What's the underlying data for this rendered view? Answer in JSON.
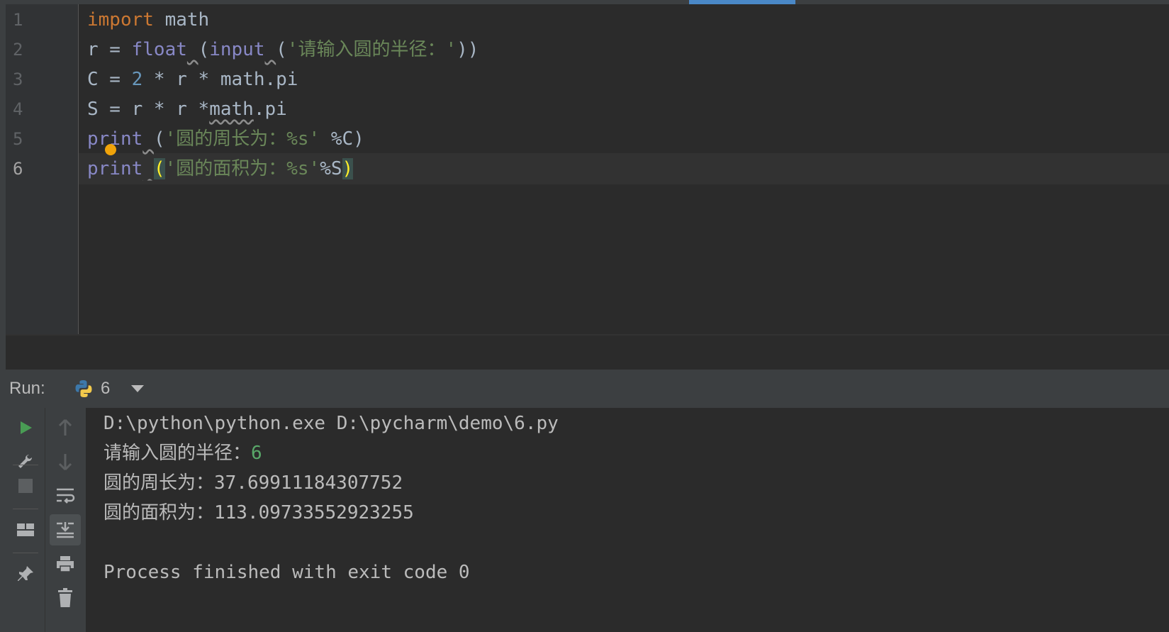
{
  "editor": {
    "line_numbers": [
      "1",
      "2",
      "3",
      "4",
      "5",
      "6"
    ],
    "lines": {
      "l1": {
        "import_kw": "import",
        "rest": " math"
      },
      "l2": {
        "var": "r = ",
        "float": "float",
        "sp1": " ",
        "p1": "(",
        "input": "input",
        "sp2": " ",
        "p2": "(",
        "str": "'请输入圆的半径：'",
        "close": "))"
      },
      "l3": {
        "start": "C = ",
        "num": "2",
        "rest": " * r * math.pi"
      },
      "l4": {
        "start": "S = r * r *",
        "math": "math",
        "rest": ".pi"
      },
      "l5": {
        "print": "print",
        "sp": " ",
        "p": "(",
        "str": "'圆的周长为：%s'",
        "rest": " %C)"
      },
      "l6": {
        "print": "print",
        "sp": " ",
        "p": "(",
        "str": "'圆的面积为：%s'",
        "rest": "%S",
        "close": ")"
      }
    }
  },
  "run_panel": {
    "label": "Run:",
    "config_name": "6",
    "console": {
      "command": "D:\\python\\python.exe D:\\pycharm\\demo\\6.py",
      "prompt": "请输入圆的半径：",
      "user_input": "6",
      "circumference": "圆的周长为：37.69911184307752",
      "area": "圆的面积为：113.09733552923255",
      "exit_message": "Process finished with exit code 0"
    }
  },
  "colors": {
    "run_green": "#499c54",
    "keyword": "#cc7832",
    "builtin": "#8888c6",
    "string": "#6a8759",
    "number": "#6897bb",
    "input_green": "#59a869"
  },
  "icons": {
    "toolbar_left": [
      "run-icon",
      "wrench-icon",
      "stop-icon",
      "layout-icon",
      "pin-icon"
    ],
    "toolbar_right": [
      "arrow-up-icon",
      "arrow-down-icon",
      "soft-wrap-icon",
      "scroll-to-end-icon",
      "print-icon",
      "trash-icon"
    ]
  }
}
